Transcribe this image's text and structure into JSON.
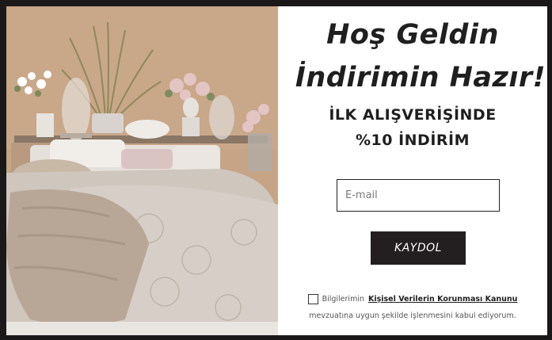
{
  "popup": {
    "title_line1": "Hoş Geldin",
    "title_line2": "İndirimin Hazır!",
    "subtitle_line1": "İLK ALIŞVERİŞİNDE",
    "subtitle_line2": "%10 İNDİRİM",
    "email_placeholder": "E-mail",
    "email_value": "",
    "submit_label": "KAYDOL",
    "consent_prefix": "Bilgilerimin",
    "consent_link": "Kişisel Verilerin Korunması Kanunu",
    "consent_suffix": "mevzuatına uygun şekilde işlenmesini kabul ediyorum.",
    "consent_checked": false
  },
  "colors": {
    "overlay": "#1a1818",
    "button_bg": "#231f20",
    "text": "#1f1f1f"
  }
}
